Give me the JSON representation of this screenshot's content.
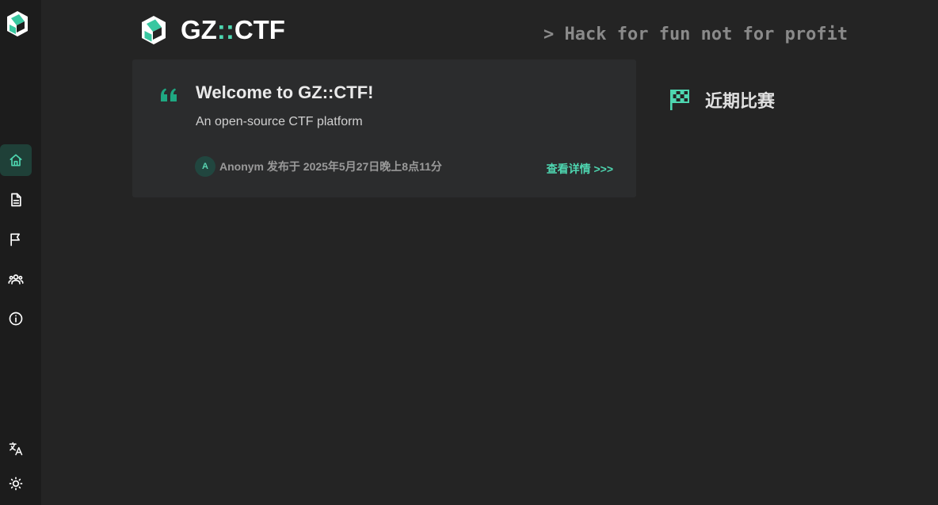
{
  "header": {
    "brand_prefix": "GZ",
    "brand_sep": "::",
    "brand_suffix": "CTF",
    "slogan": "> Hack for fun not for profit"
  },
  "sidebar": {
    "items": [
      {
        "name": "home",
        "icon": "home-icon",
        "active": true
      },
      {
        "name": "posts",
        "icon": "document-icon",
        "active": false
      },
      {
        "name": "games",
        "icon": "flag-icon",
        "active": false
      },
      {
        "name": "teams",
        "icon": "users-icon",
        "active": false
      },
      {
        "name": "about",
        "icon": "info-icon",
        "active": false
      }
    ],
    "bottom": [
      {
        "name": "language",
        "icon": "translate-icon"
      },
      {
        "name": "theme",
        "icon": "sun-icon"
      }
    ]
  },
  "post": {
    "title": "Welcome to GZ::CTF!",
    "summary": "An open-source CTF platform",
    "avatar_letter": "A",
    "meta": "Anonym 发布于 2025年5月27日晚上8点11分",
    "details_link": "查看详情 >>>"
  },
  "recent_games": {
    "title": "近期比赛"
  },
  "colors": {
    "accent": "#4ed6b0",
    "background": "#242424",
    "sidebar": "#1c1c1c",
    "card": "#2b2c2d"
  }
}
